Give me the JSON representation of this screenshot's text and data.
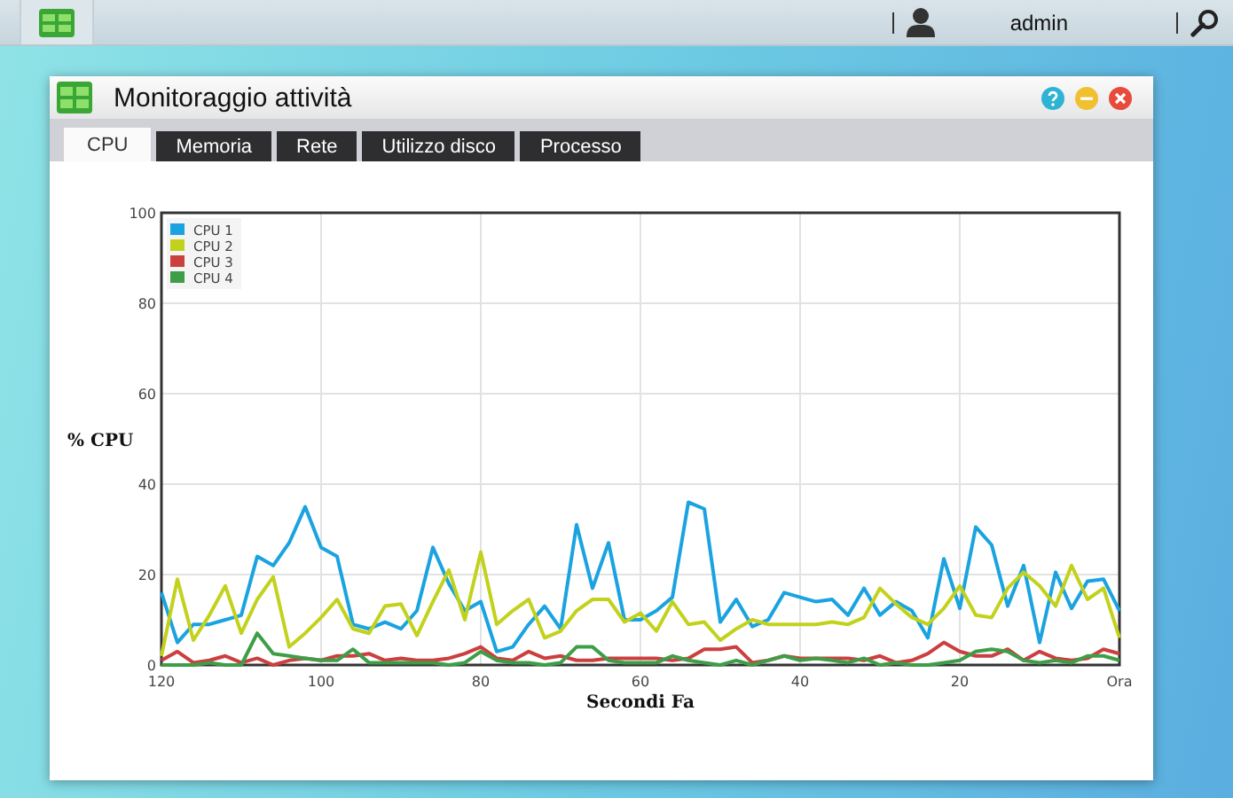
{
  "top_bar": {
    "user": "admin"
  },
  "window": {
    "title": "Monitoraggio attività"
  },
  "tabs": [
    {
      "label": "CPU",
      "selected": true
    },
    {
      "label": "Memoria",
      "selected": false
    },
    {
      "label": "Rete",
      "selected": false
    },
    {
      "label": "Utilizzo disco",
      "selected": false
    },
    {
      "label": "Processo",
      "selected": false
    }
  ],
  "chart_data": {
    "type": "line",
    "xlabel": "Secondi Fa",
    "ylabel": "% CPU",
    "x": [
      120,
      118,
      116,
      114,
      112,
      110,
      108,
      106,
      104,
      102,
      100,
      98,
      96,
      94,
      92,
      90,
      88,
      86,
      84,
      82,
      80,
      78,
      76,
      74,
      72,
      70,
      68,
      66,
      64,
      62,
      60,
      58,
      56,
      54,
      52,
      50,
      48,
      46,
      44,
      42,
      40,
      38,
      36,
      34,
      32,
      30,
      28,
      26,
      24,
      22,
      20,
      18,
      16,
      14,
      12,
      10,
      8,
      6,
      4,
      2,
      0
    ],
    "series": [
      {
        "name": "CPU 1",
        "color": "#1aa3e0",
        "values": [
          16,
          5,
          9,
          9,
          10,
          11,
          24,
          22,
          27,
          35,
          26,
          24,
          9,
          8,
          9.5,
          8,
          12,
          26,
          18,
          12,
          14,
          3,
          4,
          9,
          13,
          8,
          31,
          17,
          27,
          10,
          10,
          12,
          15,
          36,
          34.5,
          9.5,
          14.5,
          8.5,
          10,
          16,
          15,
          14,
          14.5,
          11,
          17,
          11,
          14,
          12,
          6,
          23.5,
          12.5,
          30.5,
          26.5,
          13,
          22,
          5,
          20.5,
          12.5,
          18.5,
          19,
          12
        ]
      },
      {
        "name": "CPU 2",
        "color": "#c2d21c",
        "values": [
          2,
          19,
          5.5,
          11,
          17.5,
          7,
          14.5,
          19.5,
          4,
          7,
          10.5,
          14.5,
          8,
          7,
          13,
          13.5,
          6.5,
          14,
          21,
          10,
          25,
          9,
          12,
          14.5,
          6,
          7.5,
          12,
          14.5,
          14.5,
          9.5,
          11.5,
          7.5,
          14,
          9,
          9.5,
          5.5,
          8,
          10,
          9,
          9,
          9,
          9,
          9.5,
          9,
          10.5,
          17,
          13.5,
          10.5,
          9,
          12.5,
          17.5,
          11,
          10.5,
          17,
          20.5,
          17.5,
          13,
          22,
          14.5,
          17,
          6
        ]
      },
      {
        "name": "CPU 3",
        "color": "#cc3f3f",
        "values": [
          1,
          3,
          0.5,
          1,
          2,
          0.5,
          1.5,
          0,
          1,
          1.5,
          1,
          2,
          2,
          2.5,
          1,
          1.5,
          1,
          1,
          1.5,
          2.5,
          4,
          1.5,
          1,
          3,
          1.5,
          2,
          1,
          1,
          1.5,
          1.5,
          1.5,
          1.5,
          1,
          1.5,
          3.5,
          3.5,
          4,
          0.5,
          1,
          2,
          1.5,
          1.5,
          1.5,
          1.5,
          1,
          2,
          0.5,
          1,
          2.5,
          5,
          3,
          2,
          2,
          3.5,
          1,
          3,
          1.5,
          1,
          1.5,
          3.5,
          2.5
        ]
      },
      {
        "name": "CPU 4",
        "color": "#3e9e48",
        "values": [
          0,
          0,
          0,
          0.5,
          0,
          0,
          7,
          2.5,
          2,
          1.5,
          1,
          1,
          3.5,
          0.5,
          0.5,
          0.5,
          0.5,
          0.5,
          0,
          0.5,
          3,
          1,
          0.5,
          0.5,
          0,
          0.5,
          4,
          4,
          1,
          0.5,
          0.5,
          0.5,
          2,
          1,
          0.5,
          0,
          1,
          0,
          1,
          2,
          1,
          1.5,
          1,
          0.5,
          1.5,
          0,
          0.5,
          0,
          0,
          0.5,
          1,
          3,
          3.5,
          3,
          1,
          0.5,
          1,
          0.5,
          2,
          2,
          1
        ]
      }
    ],
    "xlim": [
      120,
      0
    ],
    "ylim": [
      0,
      100
    ],
    "xticks": [
      120,
      100,
      80,
      60,
      40,
      20,
      {
        "value": 0,
        "label": "Ora"
      }
    ],
    "yticks": [
      0,
      20,
      40,
      60,
      80,
      100
    ],
    "grid": true,
    "legend": true
  }
}
